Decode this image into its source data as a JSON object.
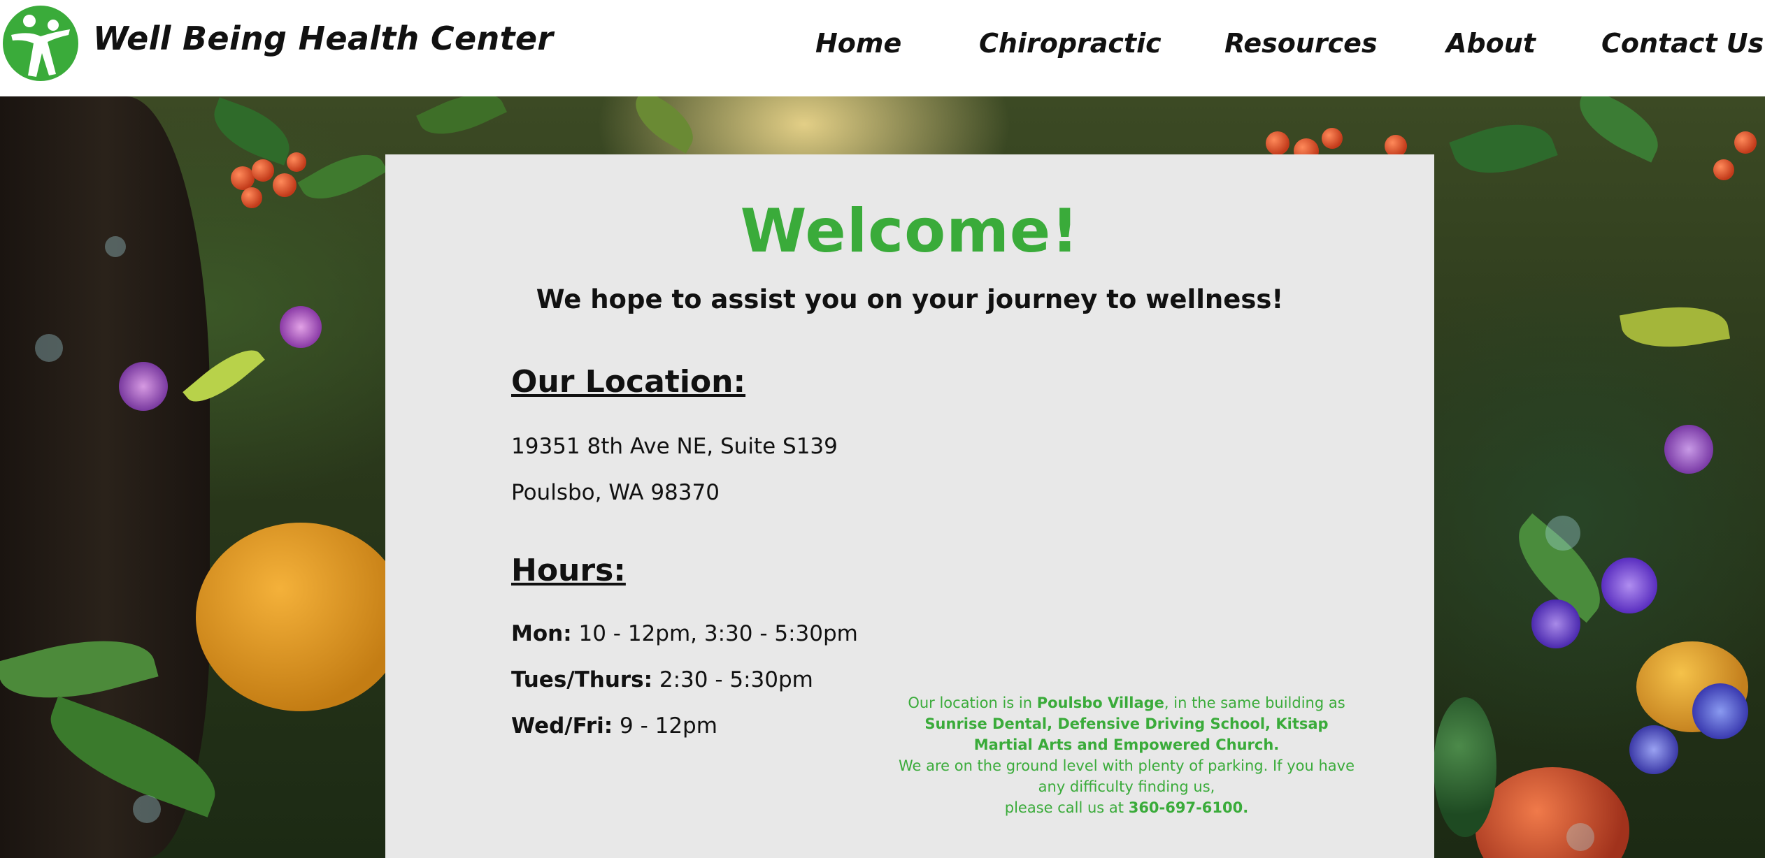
{
  "header": {
    "site_title": "Well Being Health Center",
    "nav": {
      "home": "Home",
      "chiropractic": "Chiropractic",
      "resources": "Resources",
      "about": "About",
      "contact": "Contact Us"
    }
  },
  "main": {
    "welcome": "Welcome!",
    "tagline": "We hope to assist you on your journey to wellness!",
    "location": {
      "heading": "Our Location:",
      "address_line1": "19351 8th Ave NE, Suite S139",
      "address_line2": "Poulsbo, WA 98370"
    },
    "hours": {
      "heading": "Hours:",
      "rows": [
        {
          "day": "Mon:",
          "time": " 10 - 12pm, 3:30 - 5:30pm"
        },
        {
          "day": "Tues/Thurs:",
          "time": " 2:30 - 5:30pm"
        },
        {
          "day": "Wed/Fri:",
          "time": " 9 - 12pm"
        }
      ]
    },
    "note": {
      "part1": "Our location is in ",
      "part2_bold": "Poulsbo Village",
      "part3": ", in the same building as",
      "part4_bold": "Sunrise Dental, Defensive Driving School, Kitsap Martial Arts and Empowered Church.",
      "part5": "We are on the ground level with plenty of parking. If you have any difficulty finding us,",
      "part6": "please call us at ",
      "phone": "360-697-6100."
    }
  },
  "colors": {
    "accent_green": "#3aab3a",
    "panel_bg": "#e8e8e8",
    "text": "#111111"
  },
  "icons": {
    "logo": "two-people-figure-logo-icon"
  }
}
